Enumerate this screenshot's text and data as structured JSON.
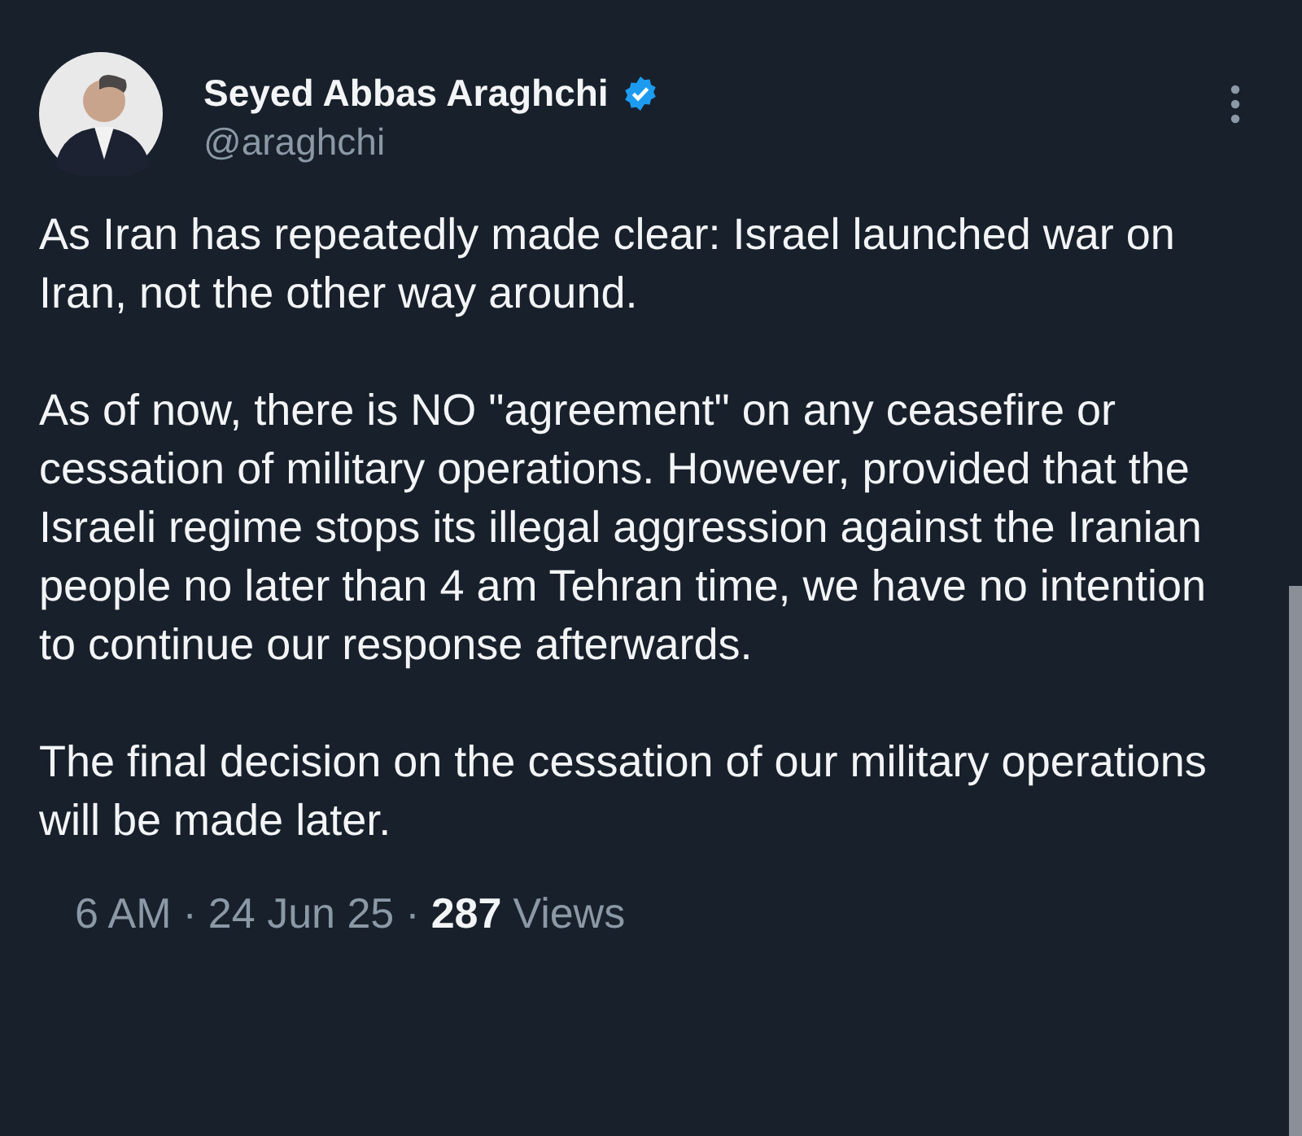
{
  "tweet": {
    "author": {
      "name": "Seyed Abbas Araghchi",
      "verified": true,
      "handle": "@araghchi"
    },
    "paragraphs": [
      "As Iran has repeatedly made clear: Israel launched war on Iran, not the other way around.",
      "As of now, there is NO \"agreement\" on any ceasefire or cessation of military operations. However, provided that the Israeli regime stops its illegal aggression against the Iranian people no later than 4 am Tehran time, we have no intention to continue our response afterwards.",
      "The final decision on the cessation of our military operations will be made later."
    ],
    "footer": {
      "time": "6 AM",
      "separator_1": "·",
      "date": "24 Jun 25",
      "separator_2": "·",
      "views_count": "287",
      "views_label": "Views"
    }
  }
}
